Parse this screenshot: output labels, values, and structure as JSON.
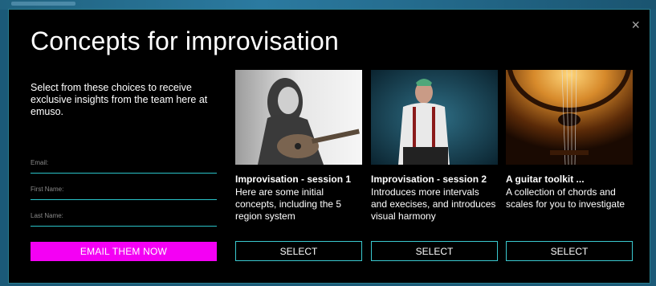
{
  "modal": {
    "title": "Concepts for improvisation",
    "close_glyph": "×",
    "intro": "Select from these choices to receive exclusive insights from the team here at emuso."
  },
  "form": {
    "email_placeholder": "Email:",
    "first_name_placeholder": "First Name:",
    "last_name_placeholder": "Last Name:",
    "submit_label": "EMAIL THEM NOW",
    "accent_color": "#f400f4"
  },
  "cards": [
    {
      "title": "Improvisation - session 1",
      "description": "Here are some initial concepts, including the 5 region system",
      "select_label": "SELECT"
    },
    {
      "title": "Improvisation - session 2",
      "description": "Introduces more intervals and execises, and introduces visual harmony",
      "select_label": "SELECT"
    },
    {
      "title": "A guitar toolkit ...",
      "description": "A collection of chords and scales for you to investigate",
      "select_label": "SELECT"
    }
  ],
  "colors": {
    "border": "#3ac9cf",
    "background": "#000000"
  }
}
